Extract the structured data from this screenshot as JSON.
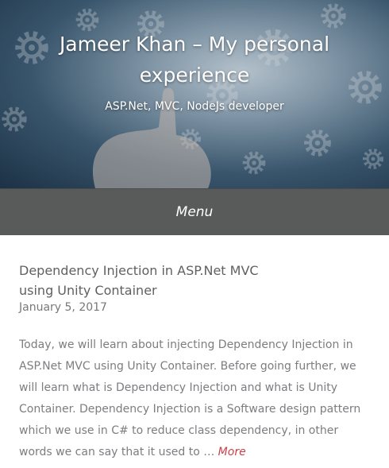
{
  "header": {
    "site_title": "Jameer Khan – My personal experience",
    "site_description": "ASP.Net, MVC, NodeJs developer"
  },
  "navigation": {
    "menu_label": "Menu"
  },
  "post": {
    "title": "Dependency Injection in ASP.Net MVC using Unity Container",
    "date": "January 5, 2017",
    "excerpt": "Today, we will learn about injecting Dependency Injection in ASP.Net MVC using Unity Container. Before going further, we will learn what is Dependency Injection and what is Unity Container. Dependency Injection is a Software design pattern which we use in C# to reduce class dependency, in other words we can say that it used to … ",
    "more_label": "More"
  },
  "colors": {
    "menu_bar": "#595a5a",
    "more_link": "#c9424a",
    "title_text": "#5f6062",
    "body_text": "#7c7d80"
  }
}
